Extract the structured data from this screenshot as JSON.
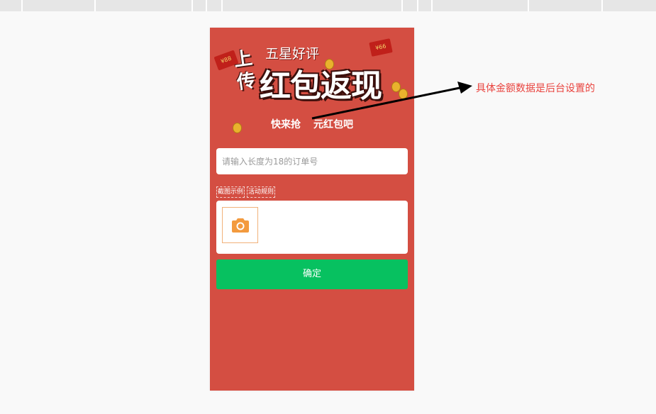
{
  "banner": {
    "side_text": "上传",
    "subtitle": "五星好评",
    "title": "红包返现",
    "envelope_left_label": "¥88",
    "envelope_right_label": "¥66",
    "slogan_part1": "快来抢",
    "slogan_part2": "元红包吧"
  },
  "form": {
    "order_placeholder": "请输入长度为18的订单号",
    "screenshot_example_link": "截图示例",
    "activity_rules_link": "活动规则",
    "upload_icon": "camera-icon",
    "confirm_label": "确定"
  },
  "annotation": {
    "text": "具体金额数据是后台设置的"
  },
  "colors": {
    "page_background": "#f9f9f9",
    "phone_background": "#d44e42",
    "confirm_button": "#07c160",
    "annotation_text": "#e9443f",
    "upload_icon": "#f39a3e"
  }
}
